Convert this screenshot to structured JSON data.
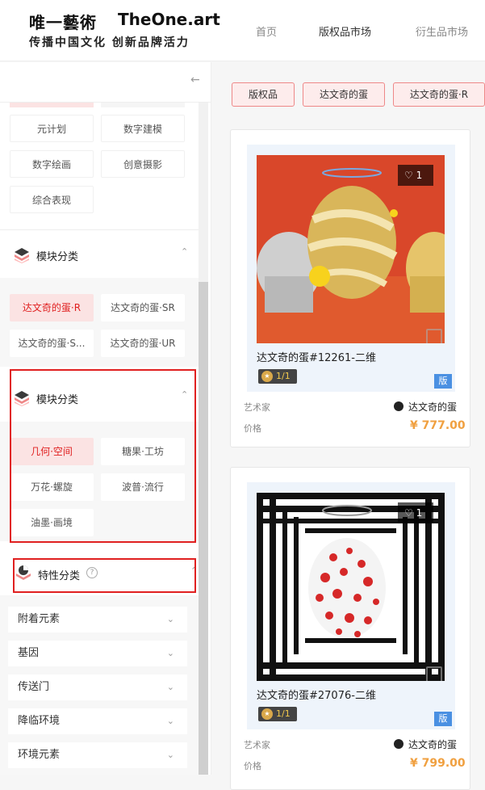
{
  "header": {
    "logo_cn": "唯一藝術",
    "logo_brand": "TheOne.art",
    "slogan": "传播中国文化  创新品牌活力",
    "nav": [
      "首页",
      "版权品市场",
      "衍生品市场"
    ]
  },
  "sidebar": {
    "top_chips": [
      "元计划",
      "数字建模",
      "数字绘画",
      "创意摄影",
      "综合表现"
    ],
    "section1": {
      "title": "模块分类",
      "chips": [
        "达文奇的蛋·R",
        "达文奇的蛋·SR",
        "达文奇的蛋·S...",
        "达文奇的蛋·UR"
      ]
    },
    "section2": {
      "title": "模块分类",
      "chips": [
        "几何·空间",
        "糖果·工坊",
        "万花·螺旋",
        "波普·流行",
        "油墨·画境"
      ]
    },
    "section3": {
      "title": "特性分类"
    },
    "filters": [
      "附着元素",
      "基因",
      "传送门",
      "降临环境",
      "环境元素"
    ]
  },
  "tags": [
    "版权品",
    "达文奇的蛋",
    "达文奇的蛋·R"
  ],
  "cards": [
    {
      "likes": "1",
      "title": "达文奇的蛋#12261-二维",
      "edition": "1/1",
      "badge": "版",
      "artist_label": "艺术家",
      "artist": "达文奇的蛋",
      "price_label": "价格",
      "price": "¥ 777.00"
    },
    {
      "likes": "1",
      "title": "达文奇的蛋#27076-二维",
      "edition": "1/1",
      "badge": "版",
      "artist_label": "艺术家",
      "artist": "达文奇的蛋",
      "price_label": "价格",
      "price": "¥ 799.00"
    }
  ],
  "colors": {
    "accent": "#e02020",
    "price": "#f0a040",
    "badge": "#4a90e2"
  }
}
